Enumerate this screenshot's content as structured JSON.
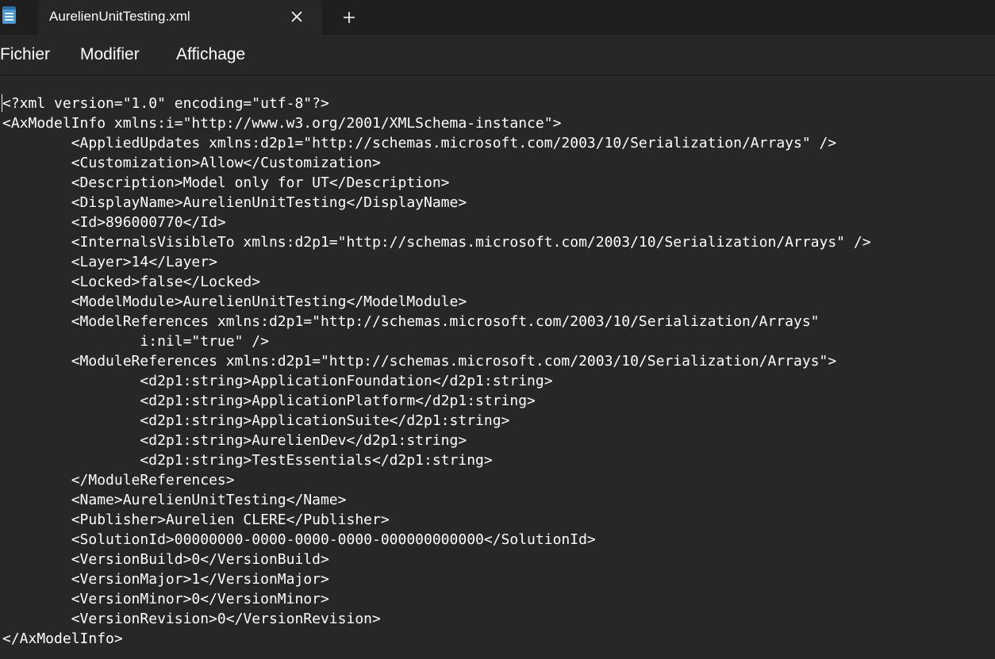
{
  "tab": {
    "title": "AurelienUnitTesting.xml",
    "close_icon": "close-icon",
    "new_tab_icon": "plus-icon",
    "app_icon": "notepad-icon"
  },
  "menu": [
    "Fichier",
    "Modifier",
    "Affichage"
  ],
  "colors": {
    "background": "#272727",
    "tabbar": "#1f1f1f",
    "text": "#ffffff",
    "icon_accent": "#4a9ad8"
  },
  "editor": {
    "lines": [
      "<?xml version=\"1.0\" encoding=\"utf-8\"?>",
      "<AxModelInfo xmlns:i=\"http://www.w3.org/2001/XMLSchema-instance\">",
      "        <AppliedUpdates xmlns:d2p1=\"http://schemas.microsoft.com/2003/10/Serialization/Arrays\" />",
      "        <Customization>Allow</Customization>",
      "        <Description>Model only for UT</Description>",
      "        <DisplayName>AurelienUnitTesting</DisplayName>",
      "        <Id>896000770</Id>",
      "        <InternalsVisibleTo xmlns:d2p1=\"http://schemas.microsoft.com/2003/10/Serialization/Arrays\" />",
      "        <Layer>14</Layer>",
      "        <Locked>false</Locked>",
      "        <ModelModule>AurelienUnitTesting</ModelModule>",
      "        <ModelReferences xmlns:d2p1=\"http://schemas.microsoft.com/2003/10/Serialization/Arrays\"",
      "                i:nil=\"true\" />",
      "        <ModuleReferences xmlns:d2p1=\"http://schemas.microsoft.com/2003/10/Serialization/Arrays\">",
      "                <d2p1:string>ApplicationFoundation</d2p1:string>",
      "                <d2p1:string>ApplicationPlatform</d2p1:string>",
      "                <d2p1:string>ApplicationSuite</d2p1:string>",
      "                <d2p1:string>AurelienDev</d2p1:string>",
      "                <d2p1:string>TestEssentials</d2p1:string>",
      "        </ModuleReferences>",
      "        <Name>AurelienUnitTesting</Name>",
      "        <Publisher>Aurelien CLERE</Publisher>",
      "        <SolutionId>00000000-0000-0000-0000-000000000000</SolutionId>",
      "        <VersionBuild>0</VersionBuild>",
      "        <VersionMajor>1</VersionMajor>",
      "        <VersionMinor>0</VersionMinor>",
      "        <VersionRevision>0</VersionRevision>",
      "</AxModelInfo>"
    ]
  }
}
